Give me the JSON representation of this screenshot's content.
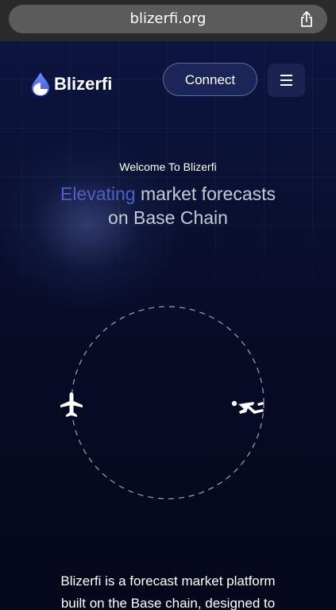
{
  "browser": {
    "url": "blizerfi.org",
    "share_icon": "share-icon"
  },
  "nav": {
    "brand": "Blizerfi",
    "connect_label": "Connect",
    "menu_icon": "hamburger-menu-icon"
  },
  "hero": {
    "welcome": "Welcome To Blizerfi",
    "headline_accent": "Elevating",
    "headline_rest_line1": " market forecasts",
    "headline_line2": "on Base Chain"
  },
  "orbit": {
    "left_icon": "airplane-icon",
    "right_icon": "sliding-person-icon"
  },
  "description": {
    "line1": "Blizerfi is a forecast market platform",
    "line2": "built on the Base chain, designed to"
  },
  "colors": {
    "accent": "#4f5fc4",
    "background": "#0a0f2a",
    "button_border": "#5a6aa8"
  }
}
